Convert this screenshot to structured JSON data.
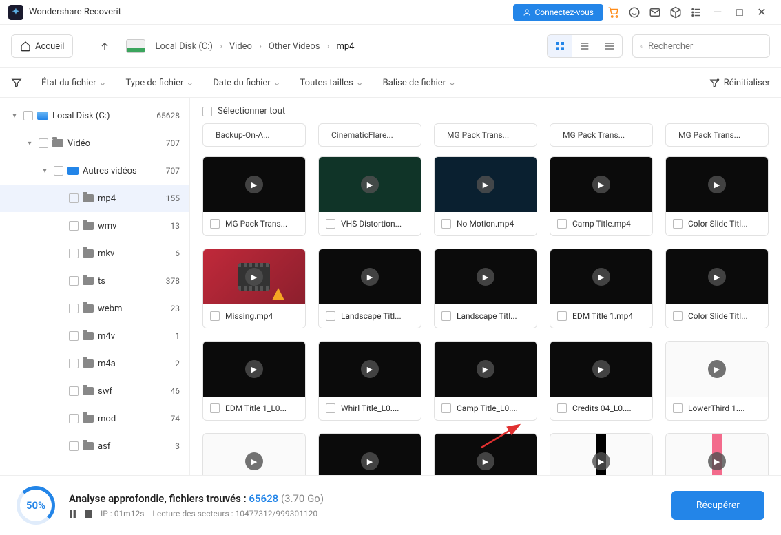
{
  "app": {
    "name": "Wondershare Recoverit"
  },
  "titlebar": {
    "connect": "Connectez-vous"
  },
  "toolbar": {
    "home": "Accueil",
    "breadcrumbs": [
      "Local Disk (C:)",
      "Video",
      "Other Videos",
      "mp4"
    ],
    "search_placeholder": "Rechercher"
  },
  "filters": {
    "state": "État du fichier",
    "type": "Type de fichier",
    "date": "Date du fichier",
    "size": "Toutes tailles",
    "tag": "Balise de fichier",
    "reset": "Réinitialiser"
  },
  "tree": [
    {
      "label": "Local Disk (C:)",
      "count": "65628",
      "depth": 0,
      "icon": "drive",
      "expanded": true
    },
    {
      "label": "Vidéo",
      "count": "707",
      "depth": 1,
      "icon": "folder",
      "expanded": true
    },
    {
      "label": "Autres vidéos",
      "count": "707",
      "depth": 2,
      "icon": "video",
      "expanded": true
    },
    {
      "label": "mp4",
      "count": "155",
      "depth": 3,
      "icon": "folder",
      "selected": true
    },
    {
      "label": "wmv",
      "count": "13",
      "depth": 3,
      "icon": "folder"
    },
    {
      "label": "mkv",
      "count": "6",
      "depth": 3,
      "icon": "folder"
    },
    {
      "label": "ts",
      "count": "378",
      "depth": 3,
      "icon": "folder"
    },
    {
      "label": "webm",
      "count": "23",
      "depth": 3,
      "icon": "folder"
    },
    {
      "label": "m4v",
      "count": "1",
      "depth": 3,
      "icon": "folder"
    },
    {
      "label": "m4a",
      "count": "2",
      "depth": 3,
      "icon": "folder"
    },
    {
      "label": "swf",
      "count": "46",
      "depth": 3,
      "icon": "folder"
    },
    {
      "label": "mod",
      "count": "74",
      "depth": 3,
      "icon": "folder"
    },
    {
      "label": "asf",
      "count": "3",
      "depth": 3,
      "icon": "folder"
    }
  ],
  "content": {
    "select_all": "Sélectionner tout",
    "collapsed_row": [
      "Backup-On-A...",
      "CinematicFlare...",
      "MG Pack Trans...",
      "MG Pack Trans...",
      "MG Pack Trans..."
    ],
    "items": [
      {
        "name": "MG Pack Trans...",
        "style": ""
      },
      {
        "name": "VHS Distortion...",
        "style": "green"
      },
      {
        "name": "No Motion.mp4",
        "style": "teal"
      },
      {
        "name": "Camp Title.mp4",
        "style": ""
      },
      {
        "name": "Color Slide Titl...",
        "style": ""
      },
      {
        "name": "Missing.mp4",
        "style": "red",
        "missing": true
      },
      {
        "name": "Landscape Titl...",
        "style": ""
      },
      {
        "name": "Landscape Titl...",
        "style": ""
      },
      {
        "name": "EDM Title 1.mp4",
        "style": ""
      },
      {
        "name": "Color Slide Titl...",
        "style": ""
      },
      {
        "name": "EDM Title 1_L0...",
        "style": ""
      },
      {
        "name": "Whirl Title_L0....",
        "style": ""
      },
      {
        "name": "Camp Title_L0....",
        "style": ""
      },
      {
        "name": "Credits 04_L0....",
        "style": ""
      },
      {
        "name": "LowerThird 1....",
        "style": "white"
      },
      {
        "name": "",
        "style": "tealbar",
        "noborder": true
      },
      {
        "name": "",
        "style": "",
        "noborder": true
      },
      {
        "name": "",
        "style": "",
        "noborder": true
      },
      {
        "name": "",
        "style": "blackbar",
        "noborder": true
      },
      {
        "name": "",
        "style": "pinkbar",
        "noborder": true
      }
    ]
  },
  "footer": {
    "headline_prefix": "Analyse approfondie, fichiers trouvés : ",
    "count": "65628",
    "size": "(3.70 Go)",
    "ip_label": "IP : 01m12s",
    "sectors_label": "Lecture des secteurs : 10477312/999301120",
    "progress": "50%",
    "recover": "Récupérer"
  }
}
